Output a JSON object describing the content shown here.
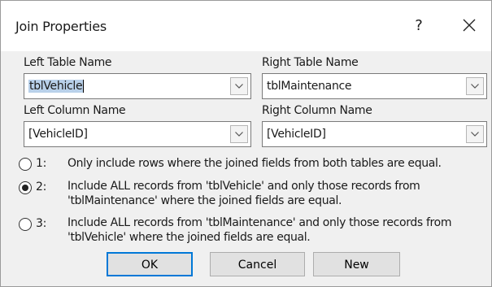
{
  "dialog": {
    "title": "Join Properties",
    "help_label": "?"
  },
  "left_table": {
    "label": "Left Table Name",
    "value": "tblVehicle"
  },
  "right_table": {
    "label": "Right Table Name",
    "value": "tblMaintenance"
  },
  "left_column": {
    "label": "Left Column Name",
    "value": "[VehicleID]"
  },
  "right_column": {
    "label": "Right Column Name",
    "value": "[VehicleID]"
  },
  "options": [
    {
      "number": "1:",
      "selected": false,
      "line1": "Only include rows where the joined fields from both tables are equal.",
      "line2": ""
    },
    {
      "number": "2:",
      "selected": true,
      "line1": "Include ALL records from 'tblVehicle' and only those records from",
      "line2": "'tblMaintenance' where the joined fields are equal."
    },
    {
      "number": "3:",
      "selected": false,
      "line1": "Include ALL records from 'tblMaintenance' and only those records from",
      "line2": "'tblVehicle' where the joined fields are equal."
    }
  ],
  "buttons": {
    "ok": "OK",
    "cancel": "Cancel",
    "new": "New"
  },
  "icons": {
    "help": "help-icon",
    "close": "close-icon",
    "dropdown": "chevron-down-icon"
  }
}
